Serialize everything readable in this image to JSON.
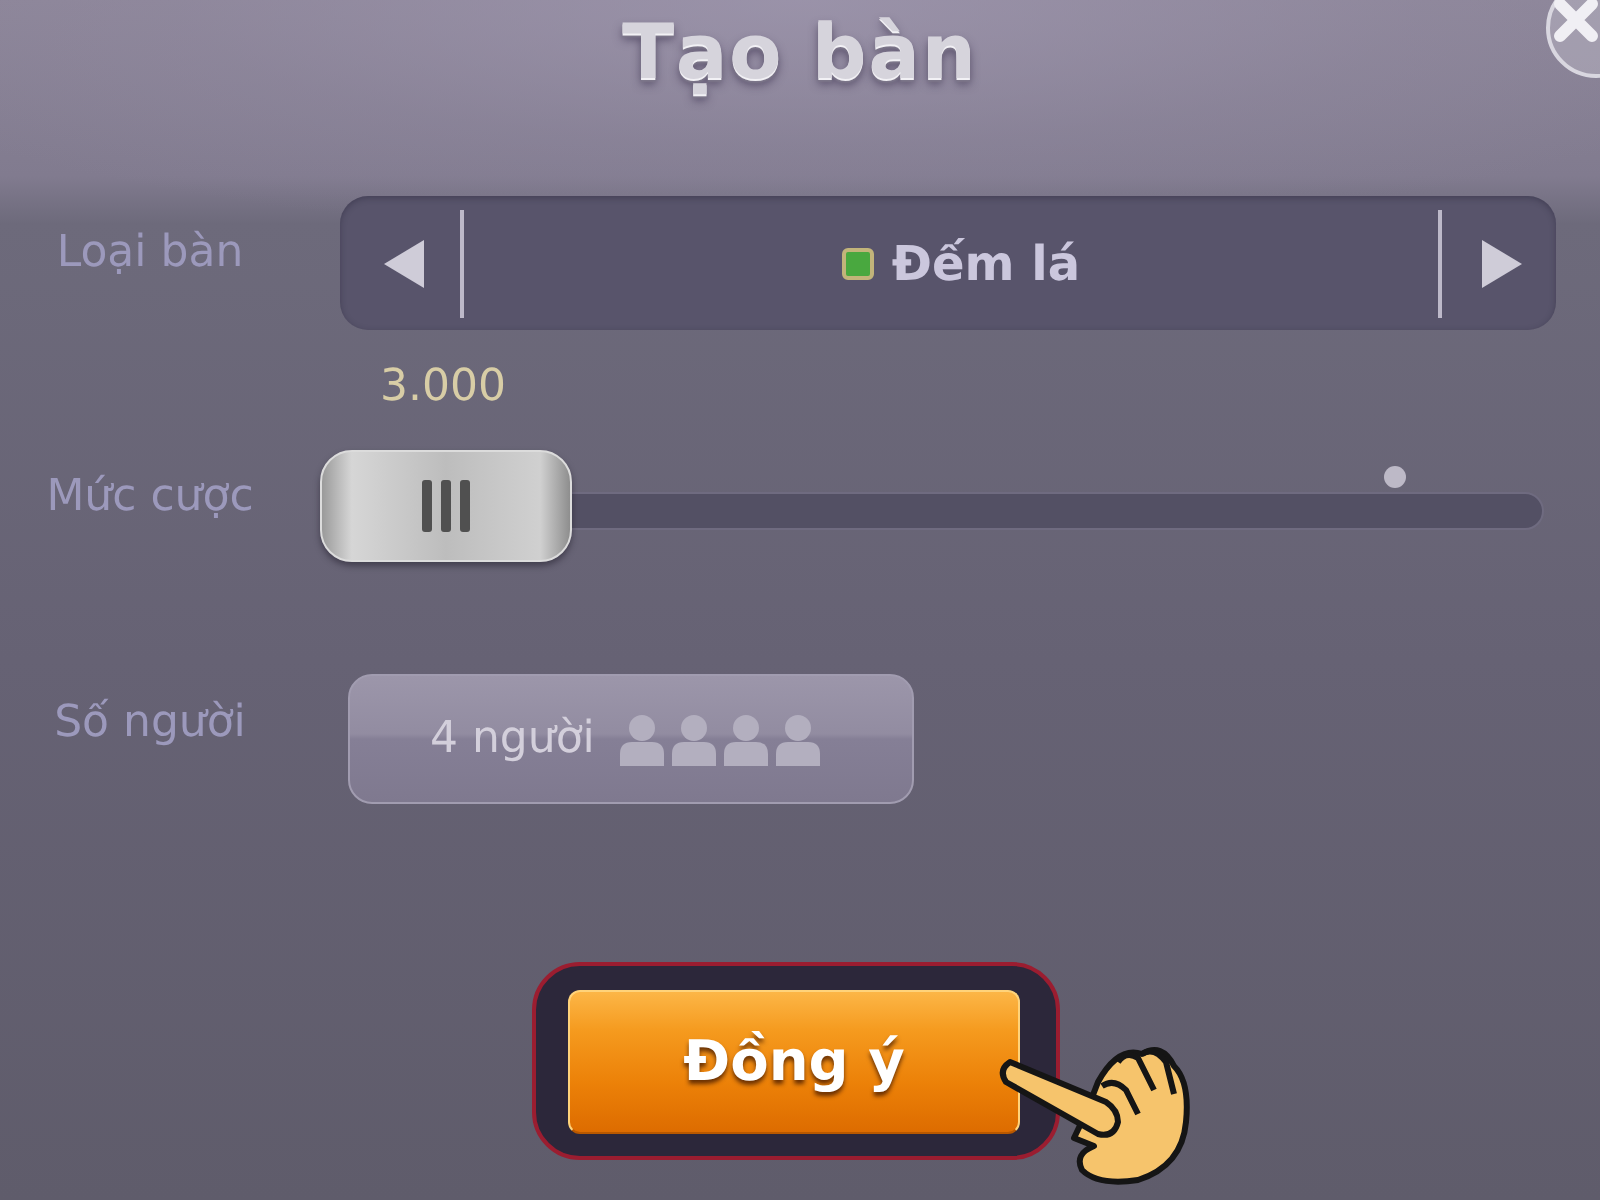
{
  "window": {
    "title": "Tạo bàn"
  },
  "rows": [
    {
      "kind": "selector",
      "label": "Loại bàn",
      "value": "Đếm lá"
    },
    {
      "kind": "slider",
      "label": "Mức cược",
      "reading": "3.000",
      "level": 0
    },
    {
      "kind": "picker",
      "label": "Số người",
      "value": "4 người"
    }
  ],
  "confirm_button": {
    "label": "Đồng ý"
  }
}
